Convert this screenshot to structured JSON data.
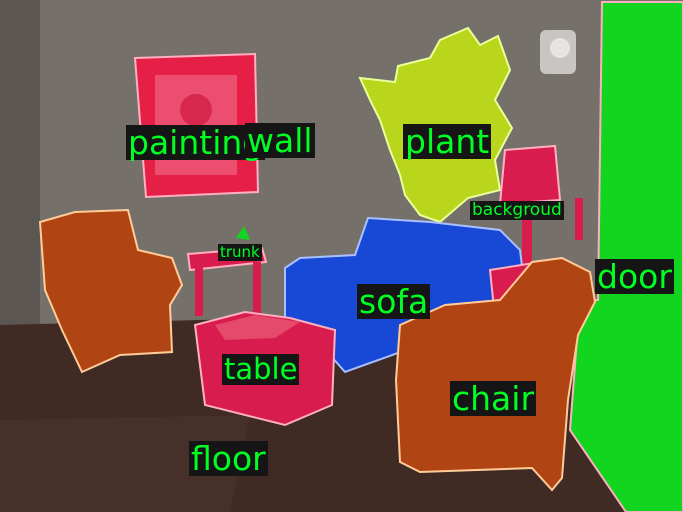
{
  "labels": {
    "painting": "painting",
    "wall": "wall",
    "plant": "plant",
    "background": "backgroud",
    "trunk": "trunk",
    "door": "door",
    "sofa": "sofa",
    "table": "table",
    "chair": "chair",
    "floor": "floor"
  },
  "colors": {
    "wall": "#76706b",
    "floor": "#3f2a24",
    "door": "#12d51f",
    "sofa": "#1748d6",
    "plant": "#b9d61c",
    "painting": "#e51f46",
    "table": "#d81c4e",
    "chair": "#b14413",
    "label_text": "#00ff22",
    "label_bg": "#151515"
  }
}
